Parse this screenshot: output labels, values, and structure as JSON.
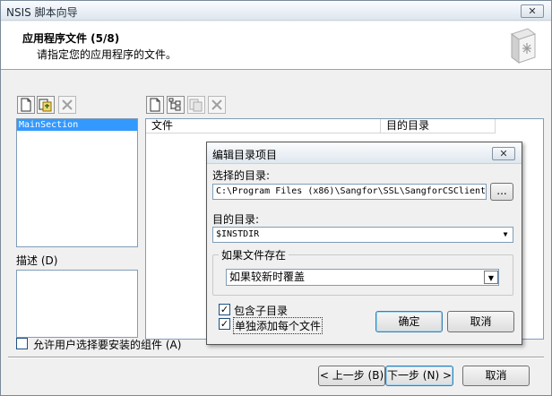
{
  "window": {
    "title": "NSIS 脚本向导",
    "close_glyph": "✕"
  },
  "header": {
    "title": "应用程序文件 (5/8)",
    "subtitle": "请指定您的应用程序的文件。"
  },
  "sections": {
    "items": [
      "MainSection"
    ]
  },
  "description": {
    "label": "描述 (D)"
  },
  "allow_user_select": {
    "label": "允许用户选择要安装的组件 (A)",
    "checked": false
  },
  "file_list": {
    "columns": [
      "文件",
      "目的目录"
    ]
  },
  "nav": {
    "back": "< 上一步 (B)",
    "next": "下一步 (N) >",
    "cancel": "取消"
  },
  "dialog": {
    "title": "编辑目录项目",
    "close_glyph": "✕",
    "selected_dir_label": "选择的目录:",
    "selected_dir_value": "C:\\Program Files (x86)\\Sangfor\\SSL\\SangforCSClient",
    "browse_label": "...",
    "dest_dir_label": "目的目录:",
    "dest_dir_value": "$INSTDIR",
    "if_exists_label": "如果文件存在",
    "if_exists_value": "如果较新时覆盖",
    "include_subdirs": {
      "label": "包含子目录",
      "checked": true
    },
    "add_each_file": {
      "label": "单独添加每个文件",
      "checked": true
    },
    "ok": "确定",
    "cancel": "取消"
  },
  "icons": [
    "new-section-icon",
    "add-subsection-icon",
    "delete-section-icon",
    "new-file-icon",
    "add-directory-icon",
    "wizard-icon",
    "delete-file-icon",
    "wizard-book-icon"
  ]
}
